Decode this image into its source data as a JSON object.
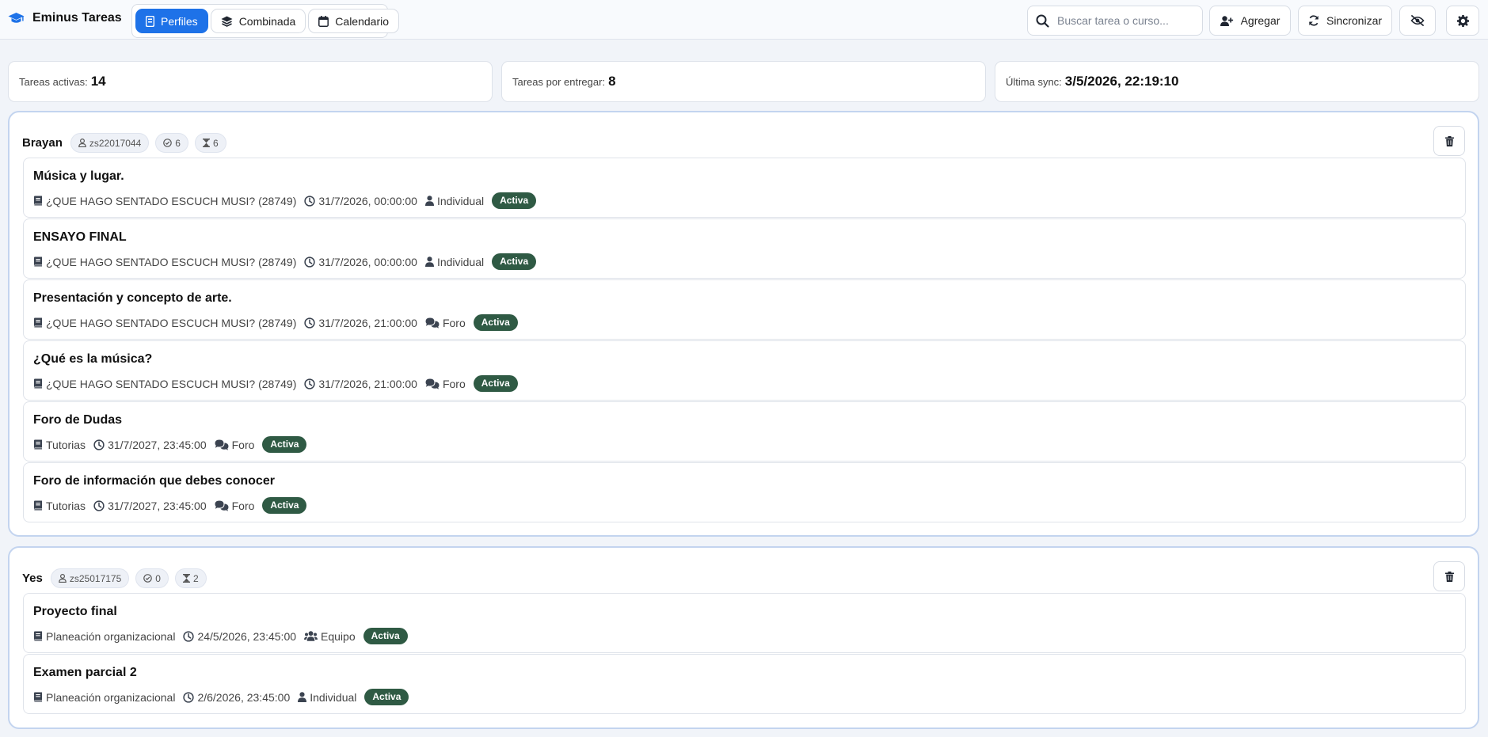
{
  "app": {
    "title": "Eminus Tareas"
  },
  "nav": {
    "tabs": [
      {
        "label": "Perfiles"
      },
      {
        "label": "Combinada"
      },
      {
        "label": "Calendario"
      }
    ]
  },
  "search": {
    "placeholder": "Buscar tarea o curso...",
    "value": ""
  },
  "toolbar": {
    "add_label": "Agregar",
    "sync_label": "Sincronizar"
  },
  "stats": {
    "active_label": "Tareas activas:",
    "active_value": "14",
    "pending_label": "Tareas por entregar:",
    "pending_value": "8",
    "sync_label": "Última sync:",
    "sync_value": "3/5/2026, 22:19:10"
  },
  "colors": {
    "accent": "#1e72e8",
    "badge_bg": "#2f5a44",
    "card_border": "#c3d4ef"
  },
  "profiles": [
    {
      "name": "Brayan",
      "id": "zs22017044",
      "completed": "6",
      "pending": "6",
      "tasks": [
        {
          "title": "Música y lugar.",
          "course": "¿QUE HAGO SENTADO ESCUCH MUSI? (28749)",
          "due": "31/7/2026, 00:00:00",
          "type": "Individual",
          "type_icon": "user-icon",
          "status": "Activa"
        },
        {
          "title": "ENSAYO FINAL",
          "course": "¿QUE HAGO SENTADO ESCUCH MUSI? (28749)",
          "due": "31/7/2026, 00:00:00",
          "type": "Individual",
          "type_icon": "user-icon",
          "status": "Activa"
        },
        {
          "title": "Presentación y concepto de arte.",
          "course": "¿QUE HAGO SENTADO ESCUCH MUSI? (28749)",
          "due": "31/7/2026, 21:00:00",
          "type": "Foro",
          "type_icon": "comments-icon",
          "status": "Activa"
        },
        {
          "title": "¿Qué es la música?",
          "course": "¿QUE HAGO SENTADO ESCUCH MUSI? (28749)",
          "due": "31/7/2026, 21:00:00",
          "type": "Foro",
          "type_icon": "comments-icon",
          "status": "Activa"
        },
        {
          "title": "Foro de Dudas",
          "course": "Tutorias",
          "due": "31/7/2027, 23:45:00",
          "type": "Foro",
          "type_icon": "comments-icon",
          "status": "Activa"
        },
        {
          "title": "Foro de información que debes conocer",
          "course": "Tutorias",
          "due": "31/7/2027, 23:45:00",
          "type": "Foro",
          "type_icon": "comments-icon",
          "status": "Activa"
        }
      ]
    },
    {
      "name": "Yes",
      "id": "zs25017175",
      "completed": "0",
      "pending": "2",
      "tasks": [
        {
          "title": "Proyecto final",
          "course": "Planeación organizacional",
          "due": "24/5/2026, 23:45:00",
          "type": "Equipo",
          "type_icon": "users-icon",
          "status": "Activa"
        },
        {
          "title": "Examen parcial 2",
          "course": "Planeación organizacional",
          "due": "2/6/2026, 23:45:00",
          "type": "Individual",
          "type_icon": "user-icon",
          "status": "Activa"
        }
      ]
    }
  ]
}
